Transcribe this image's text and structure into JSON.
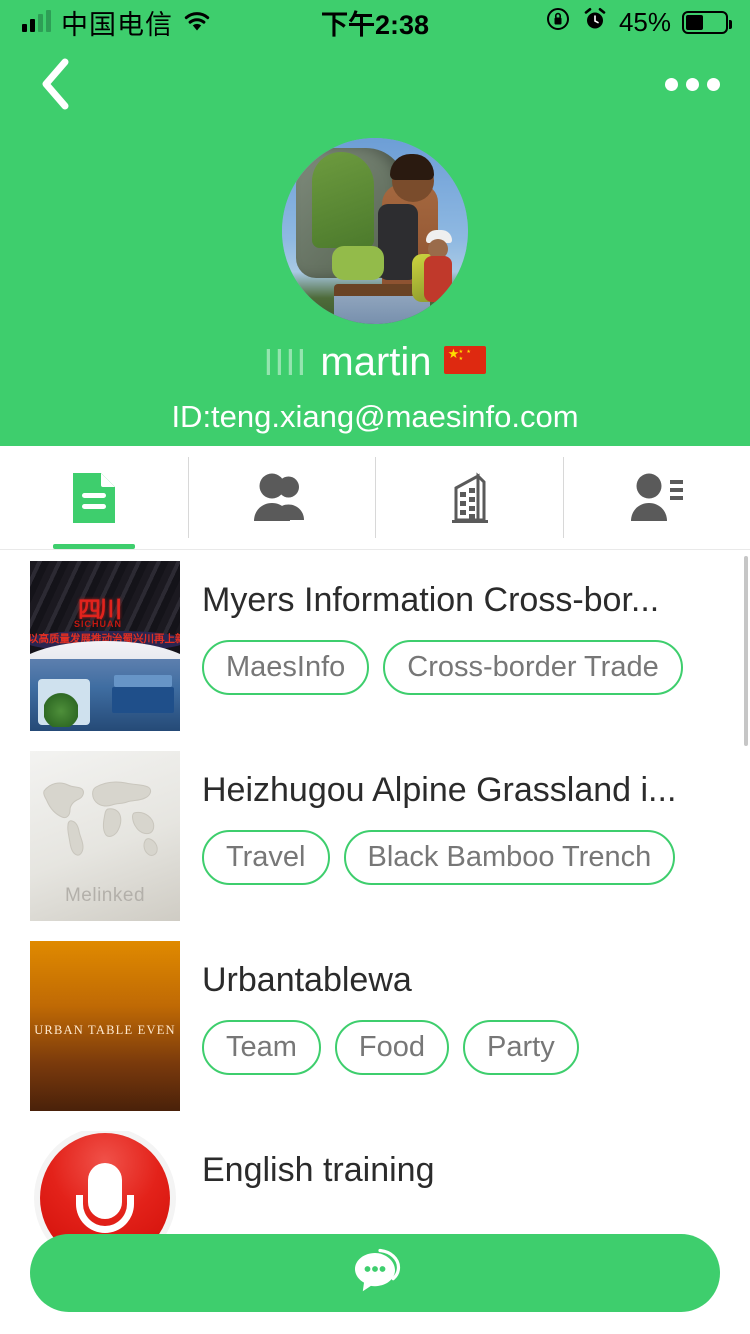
{
  "status_bar": {
    "carrier": "中国电信",
    "time": "下午2:38",
    "battery_percent": "45%",
    "icons": [
      "signal-icon",
      "wifi-icon",
      "rotation-lock-icon",
      "alarm-icon",
      "battery-icon"
    ]
  },
  "nav_bar": {
    "back_icon": "chevron-left-icon",
    "more_icon": "more-horizontal-icon"
  },
  "profile": {
    "avatar_alt": "hikers-with-backpacks-avatar",
    "name_prefix": "llll",
    "name": "martin",
    "flag": "🇨🇳",
    "id_label": "ID:teng.xiang@maesinfo.com"
  },
  "tabs": [
    {
      "name": "documents",
      "icon": "document-icon",
      "active": true
    },
    {
      "name": "groups",
      "icon": "people-icon",
      "active": false
    },
    {
      "name": "companies",
      "icon": "building-icon",
      "active": false
    },
    {
      "name": "contacts",
      "icon": "person-list-icon",
      "active": false
    }
  ],
  "list": [
    {
      "title": "Myers Information Cross-bor...",
      "thumb": "exhibition-booth-photo",
      "tags": [
        "MaesInfo",
        "Cross-border Trade"
      ]
    },
    {
      "title": "Heizhugou Alpine Grassland i...",
      "thumb": "world-map-placeholder",
      "thumb_watermark": "Melinked",
      "tags": [
        "Travel",
        "Black Bamboo Trench"
      ]
    },
    {
      "title": "Urbantablewa",
      "thumb": "orange-gradient-poster",
      "thumb_text": "URBAN TABLE EVEN",
      "tags": [
        "Team",
        "Food",
        "Party"
      ]
    },
    {
      "title": "English training",
      "thumb": "red-microphone-logo",
      "tags": [
        "",
        ""
      ]
    }
  ],
  "fab": {
    "icon": "chat-bubble-icon",
    "label": ""
  },
  "colors": {
    "brand_green": "#3ECE6D",
    "tag_border": "#3ECE6D",
    "tag_text": "#777777",
    "title_text": "#2b2b2b",
    "tab_inactive": "#5a5a5a",
    "page_bg": "#ffffff"
  }
}
